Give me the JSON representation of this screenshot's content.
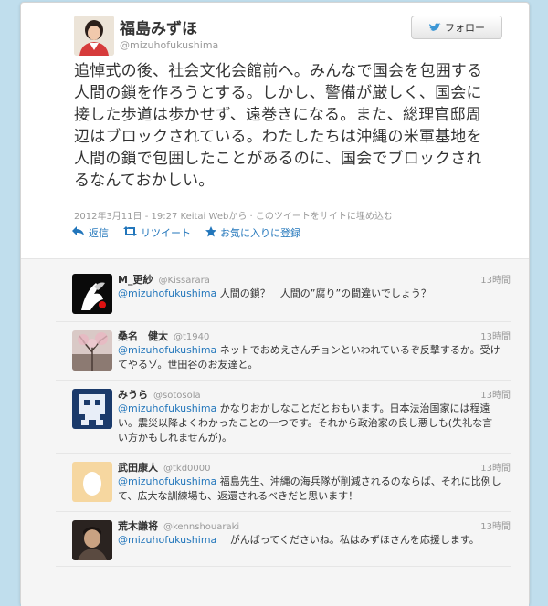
{
  "tweet": {
    "author_name": "福島みずほ",
    "author_handle": "@mizuhofukushima",
    "follow_label": "フォロー",
    "text": "追悼式の後、社会文化会館前へ。みんなで国会を包囲する人間の鎖を作ろうとする。しかし、警備が厳しく、国会に接した歩道は歩かせず、遠巻きになる。また、総理官邸周辺はブロックされている。わたしたちは沖縄の米軍基地を人間の鎖で包囲したことがあるのに、国会でブロックされるなんておかしい。",
    "timestamp": "2012年3月11日 - 19:27",
    "source": "Keitai Webから",
    "embed_link": "このツイートをサイトに埋め込む",
    "actions": {
      "reply": "返信",
      "retweet": "リツイート",
      "favorite": "お気に入りに登録"
    }
  },
  "replies": [
    {
      "name": "M_更紗",
      "handle": "@Kissarara",
      "time": "13時間",
      "mention": "@mizuhofukushima",
      "text": " 人間の鎖？　人間の”腐り”の間違いでしょう？"
    },
    {
      "name": "桑名　健太",
      "handle": "@t1940",
      "time": "13時間",
      "mention": "@mizuhofukushima",
      "text": " ネットでおめえさんチョンといわれているぞ反撃するか。受けてやるゾ。世田谷のお友達と。"
    },
    {
      "name": "みうら",
      "handle": "@sotosola",
      "time": "13時間",
      "mention": "@mizuhofukushima",
      "text": " かなりおかしなことだとおもいます。日本法治国家には程遠い。震災以降よくわかったことの一つです。それから政治家の良し悪しも(失礼な言い方かもしれませんが)。"
    },
    {
      "name": "武田康人",
      "handle": "@tkd0000",
      "time": "13時間",
      "mention": "@mizuhofukushima",
      "text": " 福島先生、沖縄の海兵隊が削減されるのならば、それに比例して、広大な訓練場も、返還されるべきだと思います！"
    },
    {
      "name": "荒木謙将",
      "handle": "@kennshouaraki",
      "time": "13時間",
      "mention": "@mizuhofukushima",
      "text": " 　がんばってくださいね。私はみずほさんを応援します。"
    }
  ],
  "colors": {
    "background": "#c0deed",
    "link": "#2276bb",
    "meta": "#999999"
  }
}
